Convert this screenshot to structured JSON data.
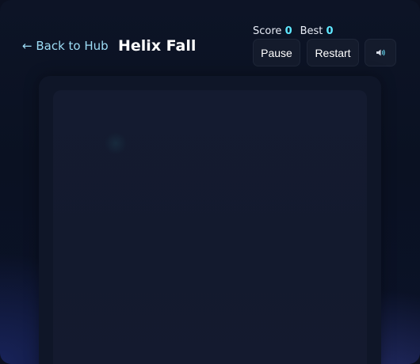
{
  "header": {
    "back_label": "← Back to Hub",
    "title": "Helix Fall"
  },
  "stats": {
    "score_label": "Score",
    "score_value": "0",
    "best_label": "Best",
    "best_value": "0"
  },
  "controls": {
    "pause_label": "Pause",
    "restart_label": "Restart",
    "sound_icon": "speaker-icon"
  },
  "colors": {
    "accent": "#5fe8ff",
    "link": "#9ddcf5",
    "background": "#0b1020"
  }
}
